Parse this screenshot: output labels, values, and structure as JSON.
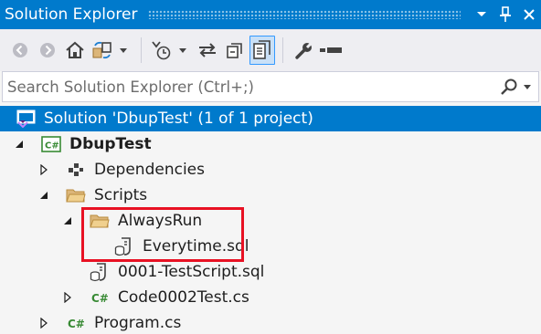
{
  "window": {
    "title": "Solution Explorer"
  },
  "search": {
    "placeholder": "Search Solution Explorer (Ctrl+;)"
  },
  "toolbar": {
    "items": [
      "back-icon",
      "forward-icon",
      "home-icon",
      "switch-views-icon",
      "dropdown-icon",
      "pending-changes-filter-icon",
      "sync-icon",
      "collapse-all-icon",
      "show-all-files-icon",
      "properties-icon",
      "preview-icon"
    ]
  },
  "tree": {
    "solution": "Solution 'DbupTest' (1 of 1 project)",
    "project": "DbupTest",
    "dependencies": "Dependencies",
    "scripts": "Scripts",
    "alwaysrun": "AlwaysRun",
    "everytime": "Everytime.sql",
    "testscript": "0001-TestScript.sql",
    "code0002": "Code0002Test.cs",
    "program": "Program.cs"
  },
  "colors": {
    "accent": "#007acc",
    "folder": "#dcb67a",
    "csharp": "#388a34",
    "highlight": "#e81123"
  }
}
